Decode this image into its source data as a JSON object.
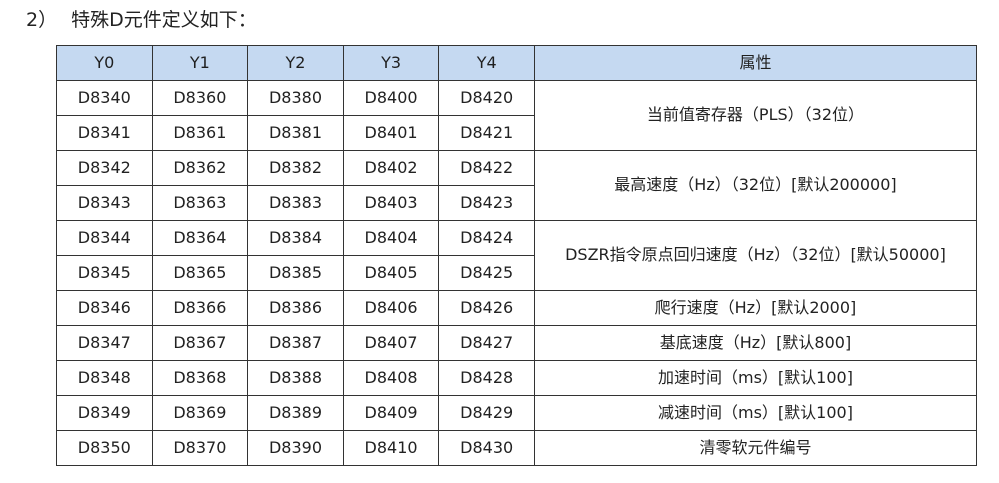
{
  "heading": {
    "number": "2）",
    "text": "特殊D元件定义如下："
  },
  "table": {
    "headers": [
      "Y0",
      "Y1",
      "Y2",
      "Y3",
      "Y4",
      "属性"
    ],
    "rows": [
      [
        "D8340",
        "D8360",
        "D8380",
        "D8400",
        "D8420"
      ],
      [
        "D8341",
        "D8361",
        "D8381",
        "D8401",
        "D8421"
      ],
      [
        "D8342",
        "D8362",
        "D8382",
        "D8402",
        "D8422"
      ],
      [
        "D8343",
        "D8363",
        "D8383",
        "D8403",
        "D8423"
      ],
      [
        "D8344",
        "D8364",
        "D8384",
        "D8404",
        "D8424"
      ],
      [
        "D8345",
        "D8365",
        "D8385",
        "D8405",
        "D8425"
      ],
      [
        "D8346",
        "D8366",
        "D8386",
        "D8406",
        "D8426"
      ],
      [
        "D8347",
        "D8367",
        "D8387",
        "D8407",
        "D8427"
      ],
      [
        "D8348",
        "D8368",
        "D8388",
        "D8408",
        "D8428"
      ],
      [
        "D8349",
        "D8369",
        "D8389",
        "D8409",
        "D8429"
      ],
      [
        "D8350",
        "D8370",
        "D8390",
        "D8410",
        "D8430"
      ]
    ],
    "attributes": [
      "当前值寄存器（PLS）（32位）",
      "最高速度（Hz）（32位）[默认200000]",
      "DSZR指令原点回归速度（Hz）（32位）[默认50000]",
      "爬行速度（Hz）[默认2000]",
      "基底速度（Hz）[默认800]",
      "加速时间（ms）[默认100]",
      "减速时间（ms）[默认100]",
      "清零软元件编号"
    ]
  },
  "colors": {
    "header_bg": "#c5d9f1",
    "border": "#333333",
    "text": "#222222"
  }
}
